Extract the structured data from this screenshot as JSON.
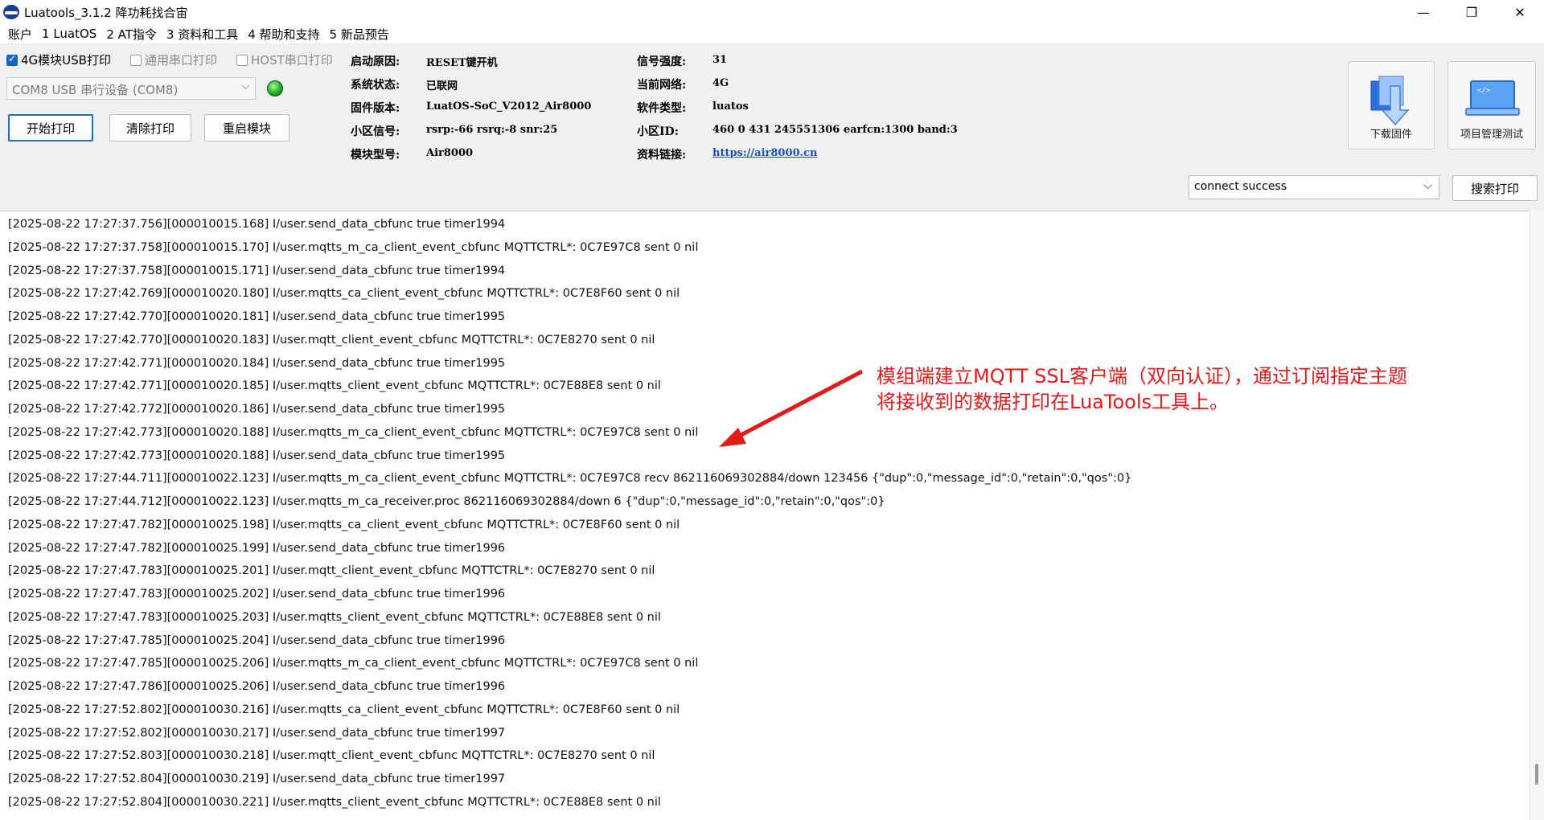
{
  "window": {
    "title": "Luatools_3.1.2 降功耗找合宙"
  },
  "menu": [
    "账户",
    "1 LuatOS",
    "2 AT指令",
    "3 资料和工具",
    "4 帮助和支持",
    "5 新品预告"
  ],
  "controls": {
    "chk_4g": "4G模块USB打印",
    "chk_serial": "通用串口打印",
    "chk_host": "HOST串口打印",
    "port": "COM8 USB 串行设备 (COM8)",
    "btn_start": "开始打印",
    "btn_clear": "清除打印",
    "btn_restart": "重启模块",
    "status_value": "connect success",
    "btn_search": "搜索打印"
  },
  "info_left": [
    {
      "label": "启动原因:",
      "value": "RESET键开机"
    },
    {
      "label": "系统状态:",
      "value": "已联网"
    },
    {
      "label": "固件版本:",
      "value": "LuatOS-SoC_V2012_Air8000"
    },
    {
      "label": "小区信号:",
      "value": "rsrp:-66 rsrq:-8 snr:25"
    },
    {
      "label": "模块型号:",
      "value": "Air8000"
    }
  ],
  "info_right": [
    {
      "label": "信号强度:",
      "value": "31"
    },
    {
      "label": "当前网络:",
      "value": "4G"
    },
    {
      "label": "软件类型:",
      "value": "luatos"
    },
    {
      "label": "小区ID:",
      "value": "460 0 431 245551306 earfcn:1300 band:3"
    },
    {
      "label": "资料链接:",
      "value": "https://air8000.cn"
    }
  ],
  "tools": {
    "download": "下载固件",
    "project": "项目管理测试"
  },
  "log": [
    "[2025-08-22 17:27:37.756][000010015.168] I/user.send_data_cbfunc true timer1994",
    "[2025-08-22 17:27:37.758][000010015.170] I/user.mqtts_m_ca_client_event_cbfunc MQTTCTRL*: 0C7E97C8 sent 0 nil",
    "[2025-08-22 17:27:37.758][000010015.171] I/user.send_data_cbfunc true timer1994",
    "[2025-08-22 17:27:42.769][000010020.180] I/user.mqtts_ca_client_event_cbfunc MQTTCTRL*: 0C7E8F60 sent 0 nil",
    "[2025-08-22 17:27:42.770][000010020.181] I/user.send_data_cbfunc true timer1995",
    "[2025-08-22 17:27:42.770][000010020.183] I/user.mqtt_client_event_cbfunc MQTTCTRL*: 0C7E8270 sent 0 nil",
    "[2025-08-22 17:27:42.771][000010020.184] I/user.send_data_cbfunc true timer1995",
    "[2025-08-22 17:27:42.771][000010020.185] I/user.mqtts_client_event_cbfunc MQTTCTRL*: 0C7E88E8 sent 0 nil",
    "[2025-08-22 17:27:42.772][000010020.186] I/user.send_data_cbfunc true timer1995",
    "[2025-08-22 17:27:42.773][000010020.188] I/user.mqtts_m_ca_client_event_cbfunc MQTTCTRL*: 0C7E97C8 sent 0 nil",
    "[2025-08-22 17:27:42.773][000010020.188] I/user.send_data_cbfunc true timer1995",
    "[2025-08-22 17:27:44.711][000010022.123] I/user.mqtts_m_ca_client_event_cbfunc MQTTCTRL*: 0C7E97C8 recv 862116069302884/down 123456 {\"dup\":0,\"message_id\":0,\"retain\":0,\"qos\":0}",
    "[2025-08-22 17:27:44.712][000010022.123] I/user.mqtts_m_ca_receiver.proc 862116069302884/down 6 {\"dup\":0,\"message_id\":0,\"retain\":0,\"qos\":0}",
    "[2025-08-22 17:27:47.782][000010025.198] I/user.mqtts_ca_client_event_cbfunc MQTTCTRL*: 0C7E8F60 sent 0 nil",
    "[2025-08-22 17:27:47.782][000010025.199] I/user.send_data_cbfunc true timer1996",
    "[2025-08-22 17:27:47.783][000010025.201] I/user.mqtt_client_event_cbfunc MQTTCTRL*: 0C7E8270 sent 0 nil",
    "[2025-08-22 17:27:47.783][000010025.202] I/user.send_data_cbfunc true timer1996",
    "[2025-08-22 17:27:47.783][000010025.203] I/user.mqtts_client_event_cbfunc MQTTCTRL*: 0C7E88E8 sent 0 nil",
    "[2025-08-22 17:27:47.785][000010025.204] I/user.send_data_cbfunc true timer1996",
    "[2025-08-22 17:27:47.785][000010025.206] I/user.mqtts_m_ca_client_event_cbfunc MQTTCTRL*: 0C7E97C8 sent 0 nil",
    "[2025-08-22 17:27:47.786][000010025.206] I/user.send_data_cbfunc true timer1996",
    "[2025-08-22 17:27:52.802][000010030.216] I/user.mqtts_ca_client_event_cbfunc MQTTCTRL*: 0C7E8F60 sent 0 nil",
    "[2025-08-22 17:27:52.802][000010030.217] I/user.send_data_cbfunc true timer1997",
    "[2025-08-22 17:27:52.803][000010030.218] I/user.mqtt_client_event_cbfunc MQTTCTRL*: 0C7E8270 sent 0 nil",
    "[2025-08-22 17:27:52.804][000010030.219] I/user.send_data_cbfunc true timer1997",
    "[2025-08-22 17:27:52.804][000010030.221] I/user.mqtts_client_event_cbfunc MQTTCTRL*: 0C7E88E8 sent 0 nil"
  ],
  "annotation": {
    "line1": "模组端建立MQTT SSL客户端（双向认证），通过订阅指定主题",
    "line2": "将接收到的数据打印在LuaTools工具上。",
    "color": "#e11a1a"
  }
}
